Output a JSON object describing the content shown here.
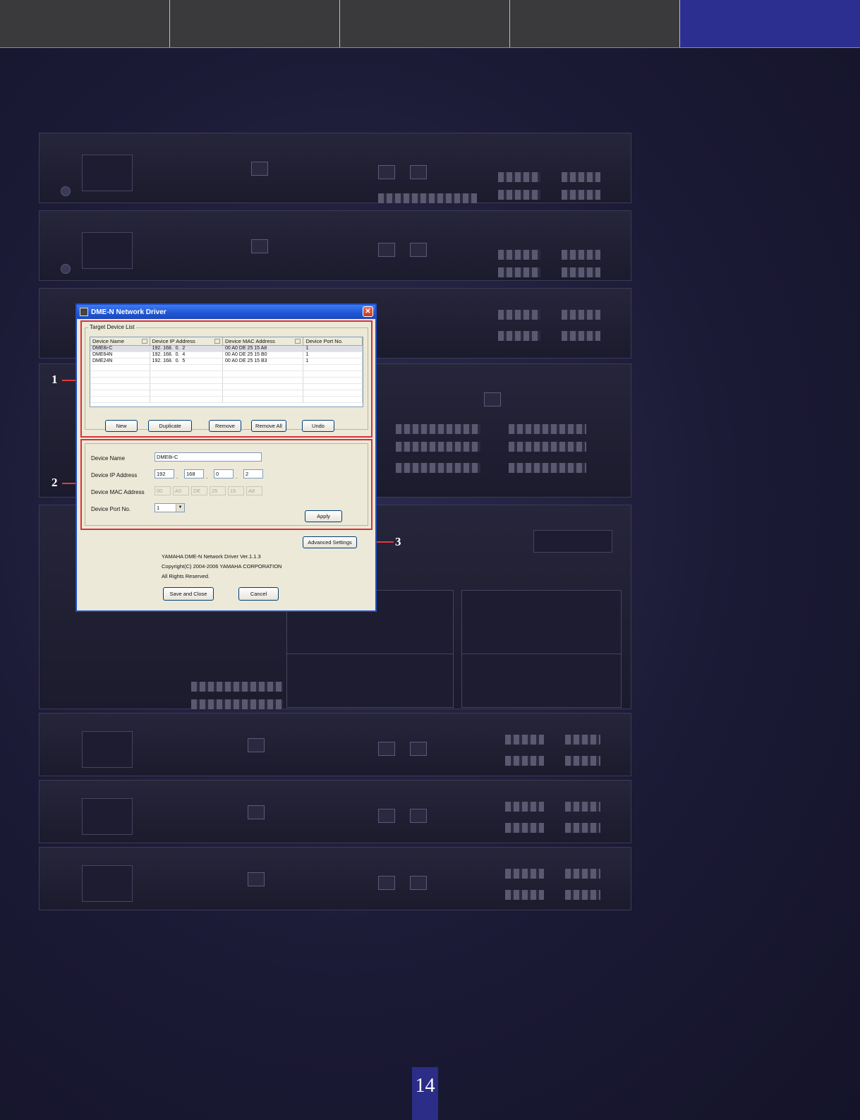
{
  "dialog": {
    "title": "DME-N Network Driver",
    "close_glyph": "✕",
    "target_device_list": {
      "legend": "Target Device List",
      "columns": [
        "Device Name",
        "Device IP Address",
        "Device MAC Address",
        "Device Port No."
      ],
      "rows": [
        [
          "DME8i-C",
          "192. 168.  0.  2",
          "00 A0 DE 25 15 A8",
          "1"
        ],
        [
          "DME64N",
          "192. 168.  0.  4",
          "00 A0 DE 25 15 B0",
          "1"
        ],
        [
          "DME24N",
          "192. 168.  0.  5",
          "00 A0 DE 25 15 B3",
          "1"
        ]
      ],
      "buttons": {
        "new": "New",
        "duplicate": "Duplicate",
        "remove": "Remove",
        "remove_all": "Remove All",
        "undo": "Undo"
      }
    },
    "device_edit": {
      "device_name_label": "Device Name",
      "device_name_value": "DME8i-C",
      "ip_label": "Device IP Address",
      "ip": [
        "192",
        "168",
        "0",
        "2"
      ],
      "mac_label": "Device MAC Address",
      "mac": [
        "00",
        "A0",
        "DE",
        "25",
        "15",
        "A8"
      ],
      "port_label": "Device Port No.",
      "port_value": "1",
      "apply": "Apply"
    },
    "advanced_settings": "Advanced Settings",
    "info": {
      "line1": "YAMAHA DME-N Network Driver Ver.1.1.3",
      "line2": "Copyright(C) 2004-2006 YAMAHA CORPORATION",
      "line3": "All Rights Reserved."
    },
    "save_and_close": "Save and Close",
    "cancel": "Cancel"
  },
  "callouts": [
    "1",
    "2",
    "3"
  ],
  "page_number": "14",
  "colors": {
    "callout_red": "#d9313b",
    "nav_active": "#2c2f8f",
    "page_badge": "#2b2d86"
  }
}
